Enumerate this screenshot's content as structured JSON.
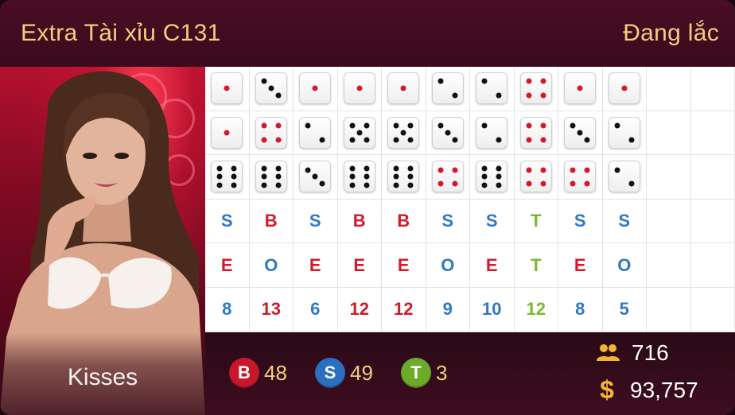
{
  "header": {
    "title": "Extra Tài xỉu C131",
    "status": "Đang lắc"
  },
  "dealer": {
    "name": "Kisses"
  },
  "colors": {
    "blue": "#2f78c4",
    "red": "#d11a2a",
    "green": "#79b82f",
    "gold": "#f2cf7e"
  },
  "road": {
    "dice_rows": [
      [
        1,
        3,
        1,
        1,
        1,
        2,
        2,
        4,
        1,
        1
      ],
      [
        1,
        4,
        2,
        5,
        5,
        3,
        2,
        4,
        3,
        2
      ],
      [
        6,
        6,
        3,
        6,
        6,
        4,
        6,
        4,
        4,
        2
      ]
    ],
    "size_row": [
      "S",
      "B",
      "S",
      "B",
      "B",
      "S",
      "S",
      "T",
      "S",
      "S"
    ],
    "parity_row": [
      "E",
      "O",
      "E",
      "E",
      "E",
      "O",
      "E",
      "T",
      "E",
      "O"
    ],
    "total_row": [
      "8",
      "13",
      "6",
      "12",
      "12",
      "9",
      "10",
      "12",
      "8",
      "5"
    ]
  },
  "stats": {
    "big": {
      "label": "B",
      "count": "48",
      "color": "#c8172a"
    },
    "small": {
      "label": "S",
      "count": "49",
      "color": "#2b6fc0"
    },
    "tie": {
      "label": "T",
      "count": "3",
      "color": "#6cab2a"
    }
  },
  "info": {
    "players": "716",
    "bets": "93,757",
    "players_icon": "users-icon",
    "bets_icon": "dollar-icon"
  }
}
